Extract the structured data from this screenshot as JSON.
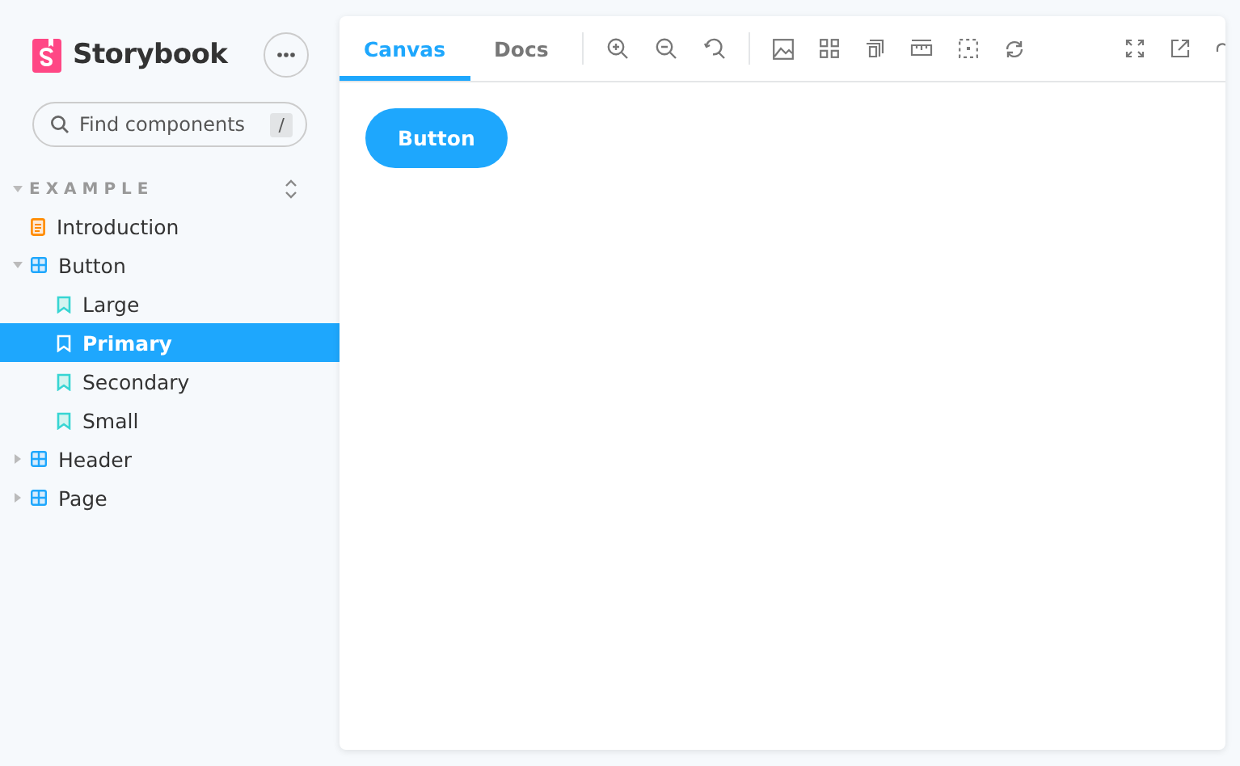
{
  "sidebar": {
    "brand": "Storybook",
    "search": {
      "placeholder": "Find components",
      "shortcut": "/"
    },
    "section": {
      "label": "EXAMPLE",
      "expanded": true
    },
    "items": [
      {
        "kind": "doc",
        "label": "Introduction",
        "selected": false
      },
      {
        "kind": "component",
        "label": "Button",
        "expanded": true,
        "selected": false,
        "children": [
          {
            "kind": "story",
            "label": "Large",
            "selected": false
          },
          {
            "kind": "story",
            "label": "Primary",
            "selected": true
          },
          {
            "kind": "story",
            "label": "Secondary",
            "selected": false
          },
          {
            "kind": "story",
            "label": "Small",
            "selected": false
          }
        ]
      },
      {
        "kind": "component",
        "label": "Header",
        "expanded": false,
        "selected": false
      },
      {
        "kind": "component",
        "label": "Page",
        "expanded": false,
        "selected": false
      }
    ]
  },
  "tabs": [
    {
      "label": "Canvas",
      "selected": true
    },
    {
      "label": "Docs",
      "selected": false
    }
  ],
  "preview": {
    "button": "Button"
  }
}
